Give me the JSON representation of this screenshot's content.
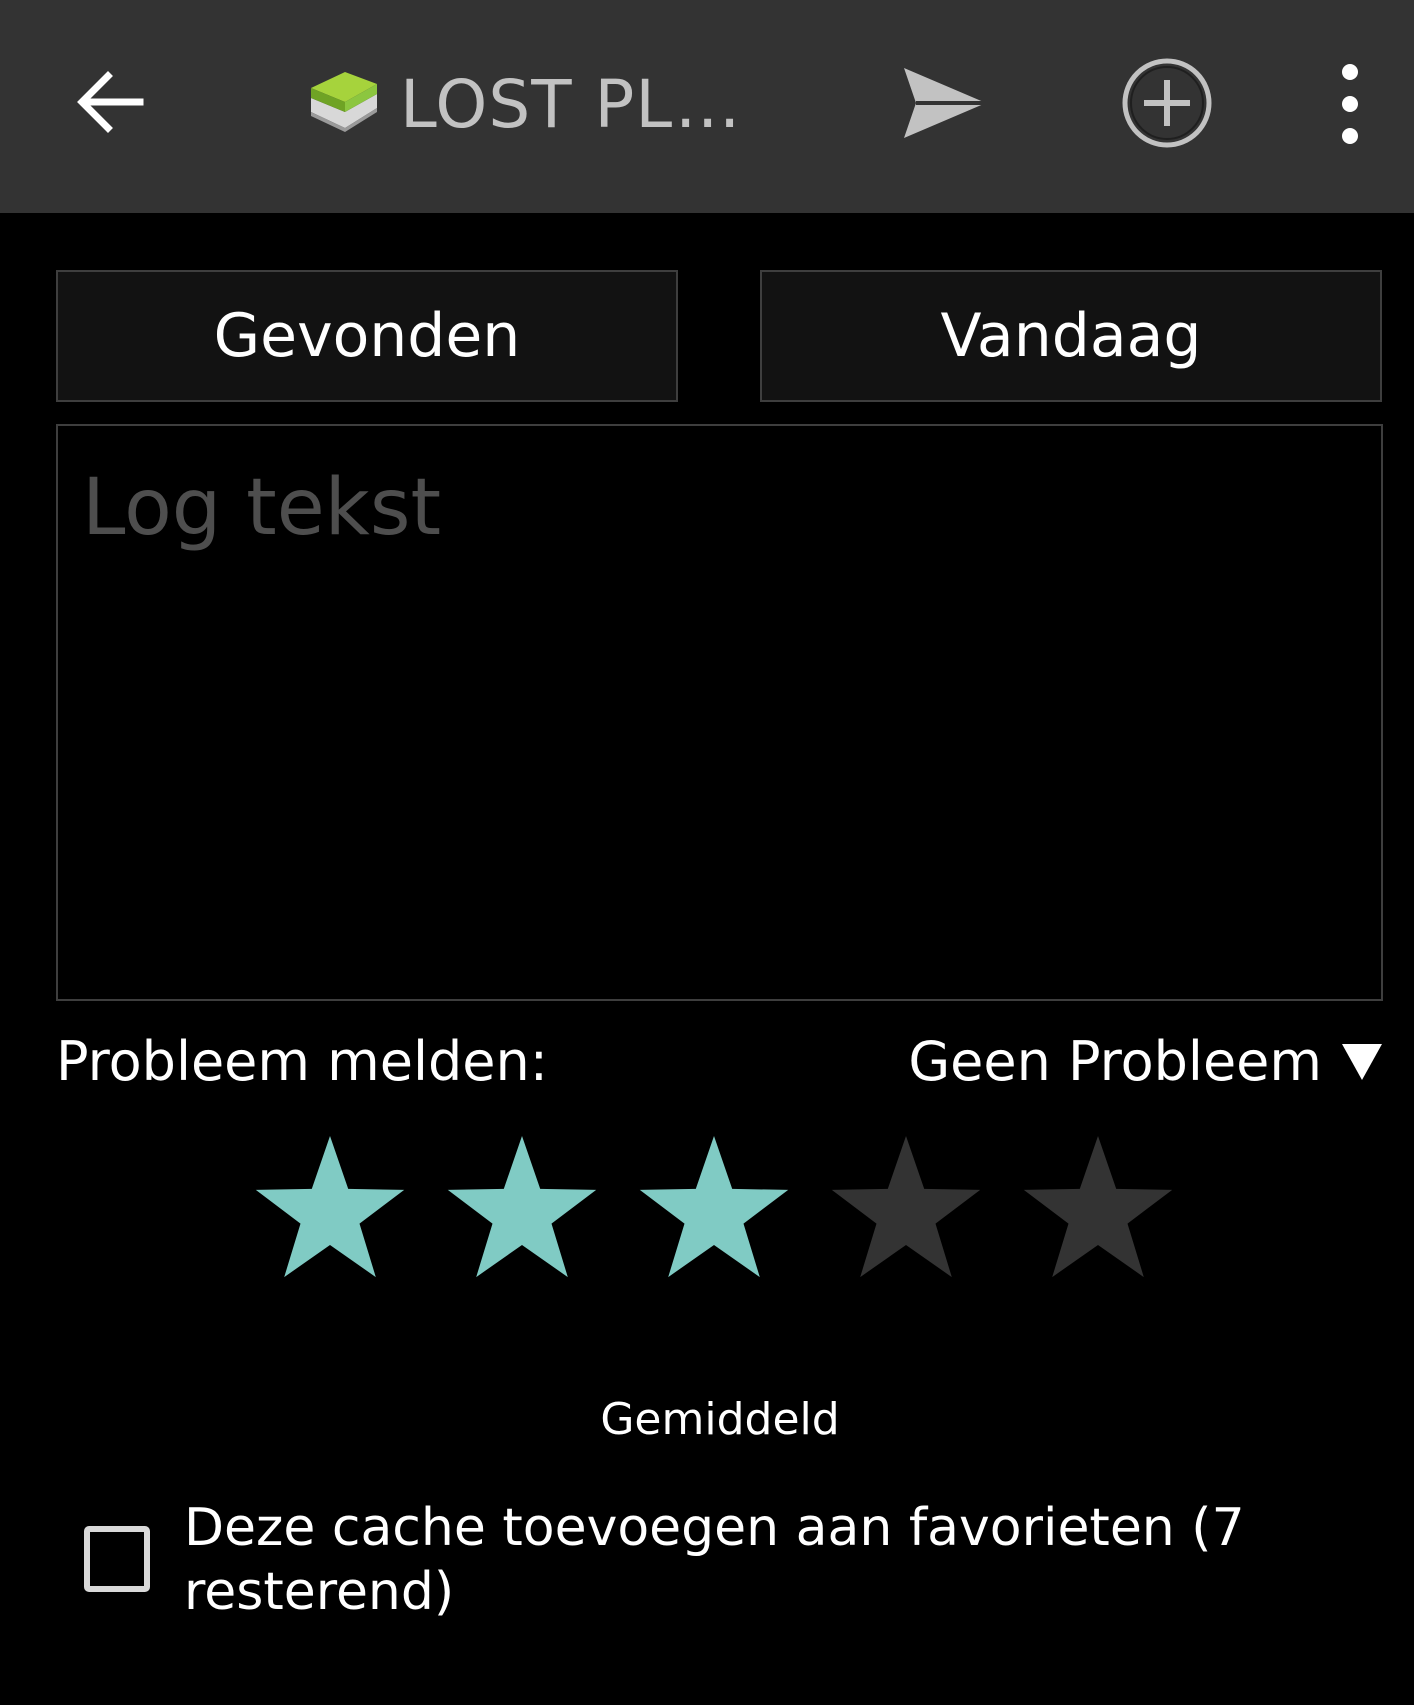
{
  "appbar": {
    "back_icon": "arrow-left-icon",
    "cache_icon": "green-book-icon",
    "title": "LOST PLA...",
    "send_icon": "send-icon",
    "add_icon": "add-circle-icon",
    "menu_icon": "more-vertical-icon"
  },
  "log": {
    "type_label": "Gevonden",
    "date_label": "Vandaag",
    "text_value": "",
    "text_placeholder": "Log tekst"
  },
  "problem": {
    "label": "Probleem melden:",
    "selected": "Geen Probleem",
    "arrow_icon": "triangle-down-icon"
  },
  "rating": {
    "value": 3,
    "max": 5,
    "label": "Gemiddeld",
    "filled_color": "#80cbc4",
    "empty_color": "#333333",
    "star_icon": "star-icon"
  },
  "favorite": {
    "checked": false,
    "label": "Deze cache toevoegen aan favorieten (7 resterend)"
  },
  "colors": {
    "appbar_bg": "#333333",
    "background": "#000000",
    "button_bg": "#121212",
    "border": "#3e3e3e",
    "placeholder": "#4e4e4e",
    "title": "#c2c2c2"
  }
}
